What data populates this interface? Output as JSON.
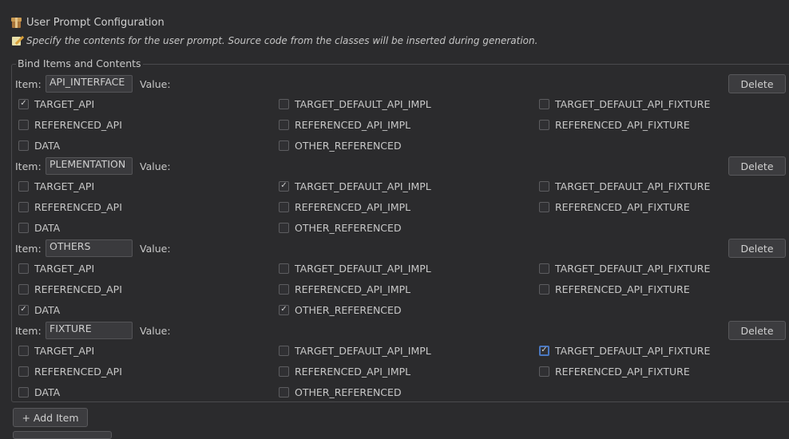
{
  "header": {
    "title": "User Prompt Configuration",
    "description": "Specify the contents for the user prompt. Source code from the classes will be inserted during generation.",
    "title_icon": "package-icon",
    "description_icon": "memo-icon"
  },
  "group": {
    "legend": "Bind Items and Contents"
  },
  "labels": {
    "item": "Item:",
    "value": "Value:",
    "delete": "Delete"
  },
  "items": [
    {
      "name": "API_INTERFACE",
      "options": [
        {
          "label": "TARGET_API",
          "checked": true
        },
        {
          "label": "TARGET_DEFAULT_API_IMPL",
          "checked": false
        },
        {
          "label": "TARGET_DEFAULT_API_FIXTURE",
          "checked": false
        },
        {
          "label": "REFERENCED_API",
          "checked": false
        },
        {
          "label": "REFERENCED_API_IMPL",
          "checked": false
        },
        {
          "label": "REFERENCED_API_FIXTURE",
          "checked": false
        },
        {
          "label": "DATA",
          "checked": false
        },
        {
          "label": "OTHER_REFERENCED",
          "checked": false
        }
      ]
    },
    {
      "name": "PLEMENTATION",
      "options": [
        {
          "label": "TARGET_API",
          "checked": false
        },
        {
          "label": "TARGET_DEFAULT_API_IMPL",
          "checked": true
        },
        {
          "label": "TARGET_DEFAULT_API_FIXTURE",
          "checked": false
        },
        {
          "label": "REFERENCED_API",
          "checked": false
        },
        {
          "label": "REFERENCED_API_IMPL",
          "checked": false
        },
        {
          "label": "REFERENCED_API_FIXTURE",
          "checked": false
        },
        {
          "label": "DATA",
          "checked": false
        },
        {
          "label": "OTHER_REFERENCED",
          "checked": false
        }
      ]
    },
    {
      "name": "OTHERS",
      "options": [
        {
          "label": "TARGET_API",
          "checked": false
        },
        {
          "label": "TARGET_DEFAULT_API_IMPL",
          "checked": false
        },
        {
          "label": "TARGET_DEFAULT_API_FIXTURE",
          "checked": false
        },
        {
          "label": "REFERENCED_API",
          "checked": false
        },
        {
          "label": "REFERENCED_API_IMPL",
          "checked": false
        },
        {
          "label": "REFERENCED_API_FIXTURE",
          "checked": false
        },
        {
          "label": "DATA",
          "checked": true
        },
        {
          "label": "OTHER_REFERENCED",
          "checked": true
        }
      ]
    },
    {
      "name": "FIXTURE",
      "options": [
        {
          "label": "TARGET_API",
          "checked": false
        },
        {
          "label": "TARGET_DEFAULT_API_IMPL",
          "checked": false
        },
        {
          "label": "TARGET_DEFAULT_API_FIXTURE",
          "checked": true,
          "focused": true
        },
        {
          "label": "REFERENCED_API",
          "checked": false
        },
        {
          "label": "REFERENCED_API_IMPL",
          "checked": false
        },
        {
          "label": "REFERENCED_API_FIXTURE",
          "checked": false
        },
        {
          "label": "DATA",
          "checked": false
        },
        {
          "label": "OTHER_REFERENCED",
          "checked": false
        }
      ]
    }
  ],
  "footer": {
    "add_item": "+ Add Item"
  }
}
